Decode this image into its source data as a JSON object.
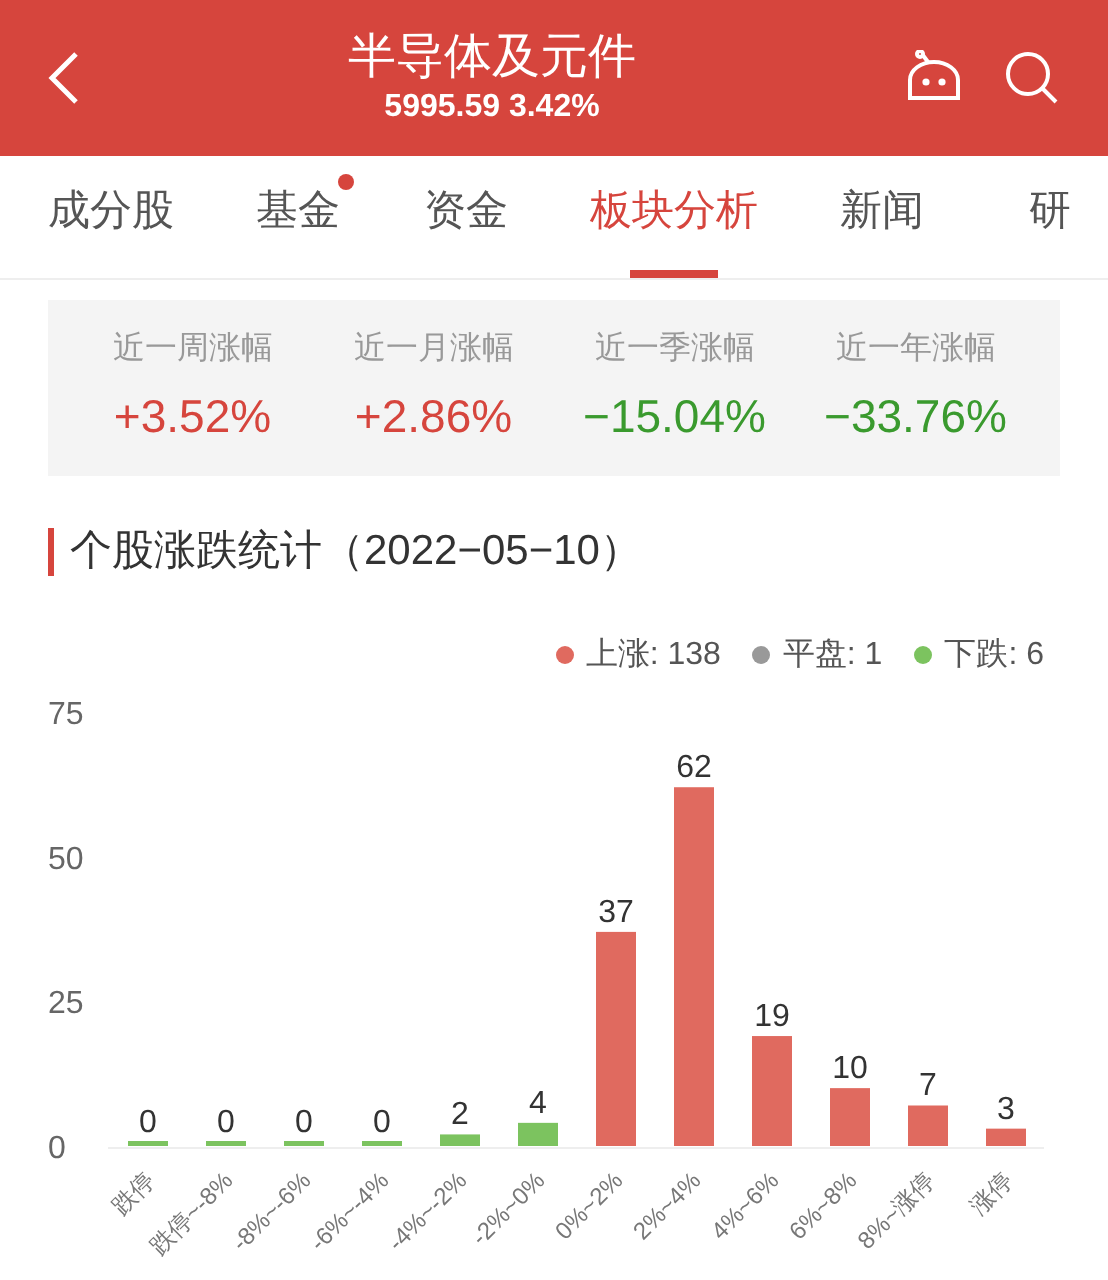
{
  "header": {
    "title": "半导体及元件",
    "quote": "5995.59 3.42%"
  },
  "tabs": [
    {
      "label": "成分股",
      "selected": false,
      "badge": false
    },
    {
      "label": "基金",
      "selected": false,
      "badge": true
    },
    {
      "label": "资金",
      "selected": false,
      "badge": false
    },
    {
      "label": "板块分析",
      "selected": true,
      "badge": false
    },
    {
      "label": "新闻",
      "selected": false,
      "badge": false
    },
    {
      "label": "研",
      "selected": false,
      "badge": false
    }
  ],
  "performance": [
    {
      "label": "近一周涨幅",
      "value": "+3.52%",
      "color": "#d6453d"
    },
    {
      "label": "近一月涨幅",
      "value": "+2.86%",
      "color": "#d6453d"
    },
    {
      "label": "近一季涨幅",
      "value": "−15.04%",
      "color": "#3a9a2e"
    },
    {
      "label": "近一年涨幅",
      "value": "−33.76%",
      "color": "#3a9a2e"
    }
  ],
  "section_title": "个股涨跌统计（2022−05−10）",
  "legend": [
    {
      "label": "上涨: 138",
      "color": "#e06a5f"
    },
    {
      "label": "平盘: 1",
      "color": "#999999"
    },
    {
      "label": "下跌: 6",
      "color": "#7cc35f"
    }
  ],
  "chart_data": {
    "type": "bar",
    "categories": [
      "跌停",
      "跌停~-8%",
      "-8%~-6%",
      "-6%~-4%",
      "-4%~-2%",
      "-2%~0%",
      "0%~2%",
      "2%~4%",
      "4%~6%",
      "6%~8%",
      "8%~涨停",
      "涨停"
    ],
    "series": [
      {
        "color": "#7cc35f",
        "values": [
          0,
          0,
          0,
          0,
          2,
          4,
          null,
          null,
          null,
          null,
          null,
          null
        ]
      },
      {
        "color": "#e06a5f",
        "values": [
          null,
          null,
          null,
          null,
          null,
          null,
          37,
          62,
          19,
          10,
          7,
          3
        ]
      }
    ],
    "ylim": [
      0,
      75
    ],
    "yticks": [
      0,
      25,
      50,
      75
    ],
    "data_labels": true
  }
}
